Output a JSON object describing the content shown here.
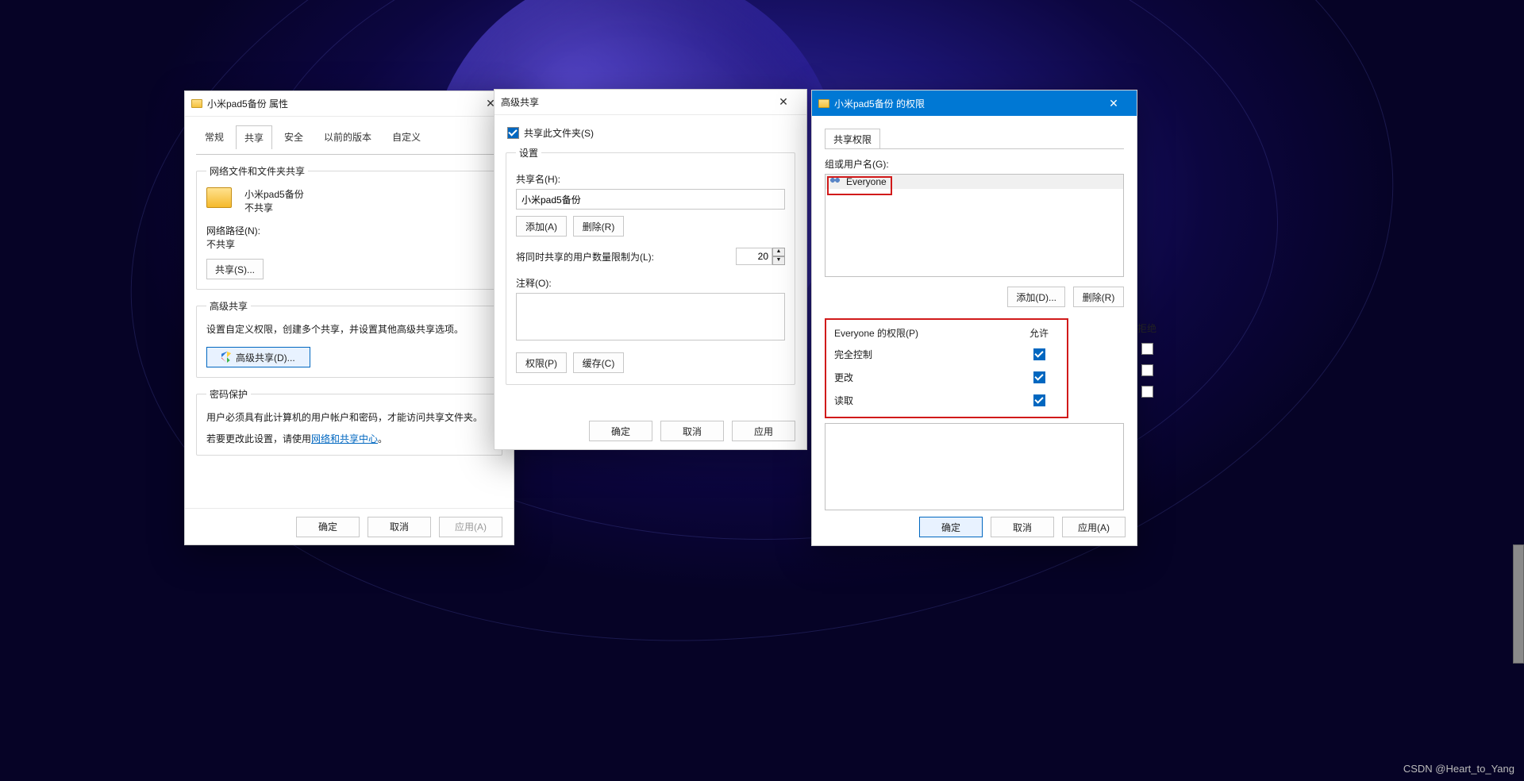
{
  "watermark": "CSDN @Heart_to_Yang",
  "props": {
    "title": "小米pad5备份 属性",
    "tabs": [
      "常规",
      "共享",
      "安全",
      "以前的版本",
      "自定义"
    ],
    "active_tab_index": 1,
    "nfs_legend": "网络文件和文件夹共享",
    "folder_name": "小米pad5备份",
    "share_state": "不共享",
    "netpath_label": "网络路径(N):",
    "netpath_value": "不共享",
    "share_btn": "共享(S)...",
    "adv_legend": "高级共享",
    "adv_desc": "设置自定义权限，创建多个共享，并设置其他高级共享选项。",
    "adv_btn": "高级共享(D)...",
    "pwd_legend": "密码保护",
    "pwd_line1": "用户必须具有此计算机的用户帐户和密码，才能访问共享文件夹。",
    "pwd_line2_pre": "若要更改此设置，请使用",
    "pwd_link": "网络和共享中心",
    "pwd_line2_post": "。",
    "ok": "确定",
    "cancel": "取消",
    "apply": "应用(A)"
  },
  "adv": {
    "title": "高级共享",
    "share_chk": "共享此文件夹(S)",
    "settings_legend": "设置",
    "sharename_label": "共享名(H):",
    "sharename_value": "小米pad5备份",
    "add_btn": "添加(A)",
    "remove_btn": "删除(R)",
    "limit_label": "将同时共享的用户数量限制为(L):",
    "limit_value": "20",
    "comment_label": "注释(O):",
    "perm_btn": "权限(P)",
    "cache_btn": "缓存(C)",
    "ok": "确定",
    "cancel": "取消",
    "apply": "应用"
  },
  "perm": {
    "title": "小米pad5备份 的权限",
    "tab": "共享权限",
    "group_label": "组或用户名(G):",
    "users": [
      "Everyone"
    ],
    "add_btn": "添加(D)...",
    "remove_btn": "删除(R)",
    "perm_for_label": "Everyone 的权限(P)",
    "col_allow": "允许",
    "col_deny": "拒绝",
    "rows": [
      {
        "name": "完全控制",
        "allow": true,
        "deny": false
      },
      {
        "name": "更改",
        "allow": true,
        "deny": false
      },
      {
        "name": "读取",
        "allow": true,
        "deny": false
      }
    ],
    "ok": "确定",
    "cancel": "取消",
    "apply": "应用(A)"
  }
}
